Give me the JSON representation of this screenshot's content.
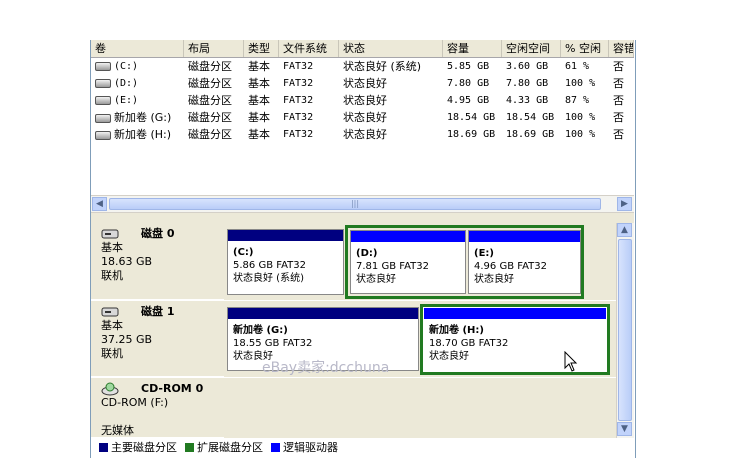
{
  "columns": [
    "卷",
    "布局",
    "类型",
    "文件系统",
    "状态",
    "容量",
    "空闲空间",
    "% 空闲",
    "容错"
  ],
  "volumes": [
    {
      "name": "(C:)",
      "layout": "磁盘分区",
      "type": "基本",
      "fs": "FAT32",
      "status": "状态良好 (系统)",
      "capacity": "5.85 GB",
      "free": "3.60 GB",
      "pct": "61 %",
      "ft": "否"
    },
    {
      "name": "(D:)",
      "layout": "磁盘分区",
      "type": "基本",
      "fs": "FAT32",
      "status": "状态良好",
      "capacity": "7.80 GB",
      "free": "7.80 GB",
      "pct": "100 %",
      "ft": "否"
    },
    {
      "name": "(E:)",
      "layout": "磁盘分区",
      "type": "基本",
      "fs": "FAT32",
      "status": "状态良好",
      "capacity": "4.95 GB",
      "free": "4.33 GB",
      "pct": "87 %",
      "ft": "否"
    },
    {
      "name": "新加卷 (G:)",
      "layout": "磁盘分区",
      "type": "基本",
      "fs": "FAT32",
      "status": "状态良好",
      "capacity": "18.54 GB",
      "free": "18.54 GB",
      "pct": "100 %",
      "ft": "否"
    },
    {
      "name": "新加卷 (H:)",
      "layout": "磁盘分区",
      "type": "基本",
      "fs": "FAT32",
      "status": "状态良好",
      "capacity": "18.69 GB",
      "free": "18.69 GB",
      "pct": "100 %",
      "ft": "否"
    }
  ],
  "hscroll_grip": "|||",
  "disks": [
    {
      "title": "磁盘 0",
      "type": "基本",
      "size": "18.63 GB",
      "state": "联机",
      "partitions": [
        {
          "name": "(C:)",
          "size_fs": "5.86 GB FAT32",
          "status": "状态良好 (系统)"
        },
        {
          "name": "(D:)",
          "size_fs": "7.81 GB FAT32",
          "status": "状态良好"
        },
        {
          "name": "(E:)",
          "size_fs": "4.96 GB FAT32",
          "status": "状态良好"
        }
      ]
    },
    {
      "title": "磁盘 1",
      "type": "基本",
      "size": "37.25 GB",
      "state": "联机",
      "partitions": [
        {
          "name": "新加卷 (G:)",
          "size_fs": "18.55 GB FAT32",
          "status": "状态良好"
        },
        {
          "name": "新加卷 (H:)",
          "size_fs": "18.70 GB FAT32",
          "status": "状态良好"
        }
      ]
    },
    {
      "title": "CD-ROM 0",
      "type": "CD-ROM (F:)",
      "size": "",
      "state": "无媒体",
      "partitions": []
    }
  ],
  "legend": [
    {
      "label": "主要磁盘分区",
      "color": "#000080"
    },
    {
      "label": "扩展磁盘分区",
      "color": "#217a21"
    },
    {
      "label": "逻辑驱动器",
      "color": "#0000ff"
    }
  ],
  "colors": {
    "primary_bar": "#000080",
    "logical_bar": "#0000ff",
    "extended_border": "#217a21"
  },
  "watermark": "eBay卖家:dcchuna"
}
